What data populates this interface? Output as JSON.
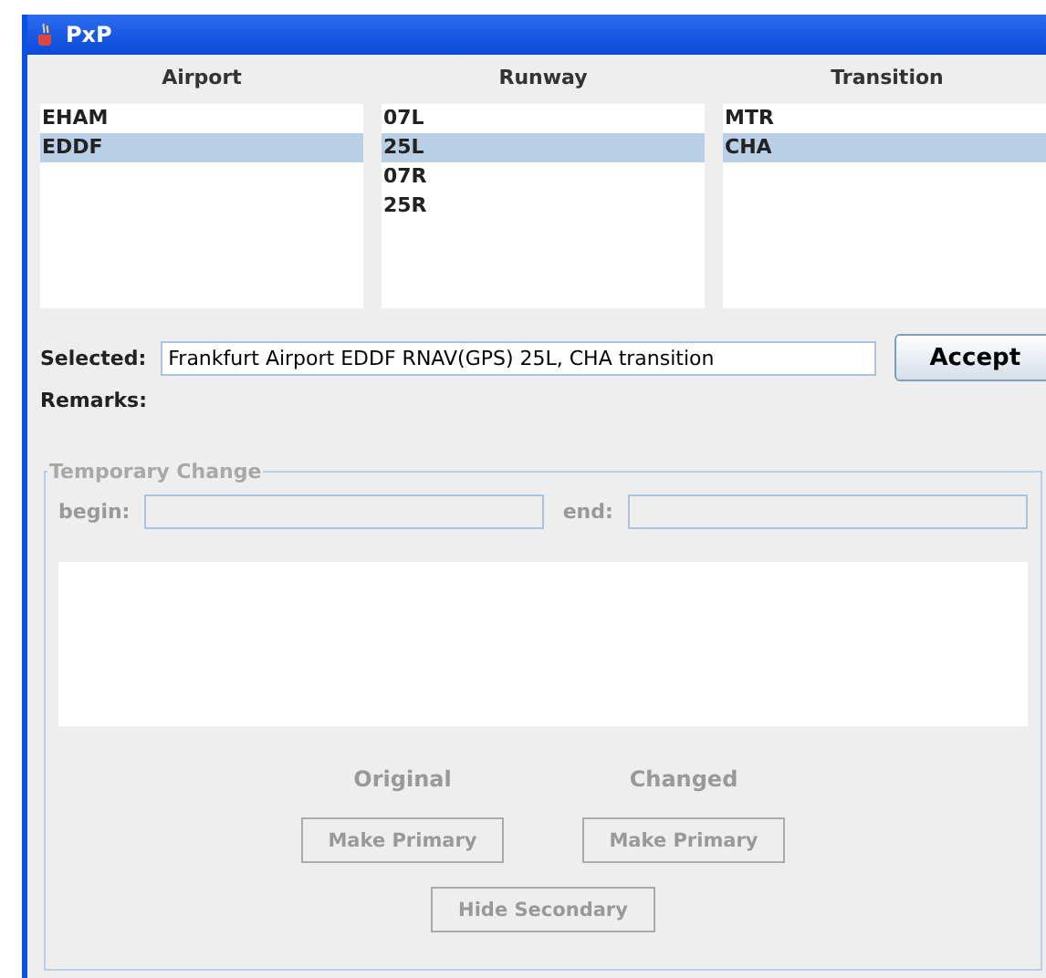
{
  "window": {
    "title": "PxP"
  },
  "lists": [
    {
      "header": "Airport",
      "items": [
        {
          "label": "EHAM",
          "selected": false
        },
        {
          "label": "EDDF",
          "selected": true
        }
      ]
    },
    {
      "header": "Runway",
      "items": [
        {
          "label": "07L",
          "selected": false
        },
        {
          "label": "25L",
          "selected": true
        },
        {
          "label": "07R",
          "selected": false
        },
        {
          "label": "25R",
          "selected": false
        }
      ]
    },
    {
      "header": "Transition",
      "items": [
        {
          "label": "MTR",
          "selected": false
        },
        {
          "label": "CHA",
          "selected": true
        }
      ]
    }
  ],
  "selected": {
    "label": "Selected:",
    "value": "Frankfurt Airport EDDF RNAV(GPS) 25L, CHA transition"
  },
  "accept_button": "Accept",
  "remarks_label": "Remarks:",
  "temporary_change": {
    "title": "Temporary Change",
    "disabled": true,
    "begin_label": "begin:",
    "end_label": "end:",
    "original_label": "Original",
    "changed_label": "Changed",
    "buttons": [
      "Make Primary",
      "Make Primary"
    ],
    "hide_button": "Hide Secondary"
  }
}
